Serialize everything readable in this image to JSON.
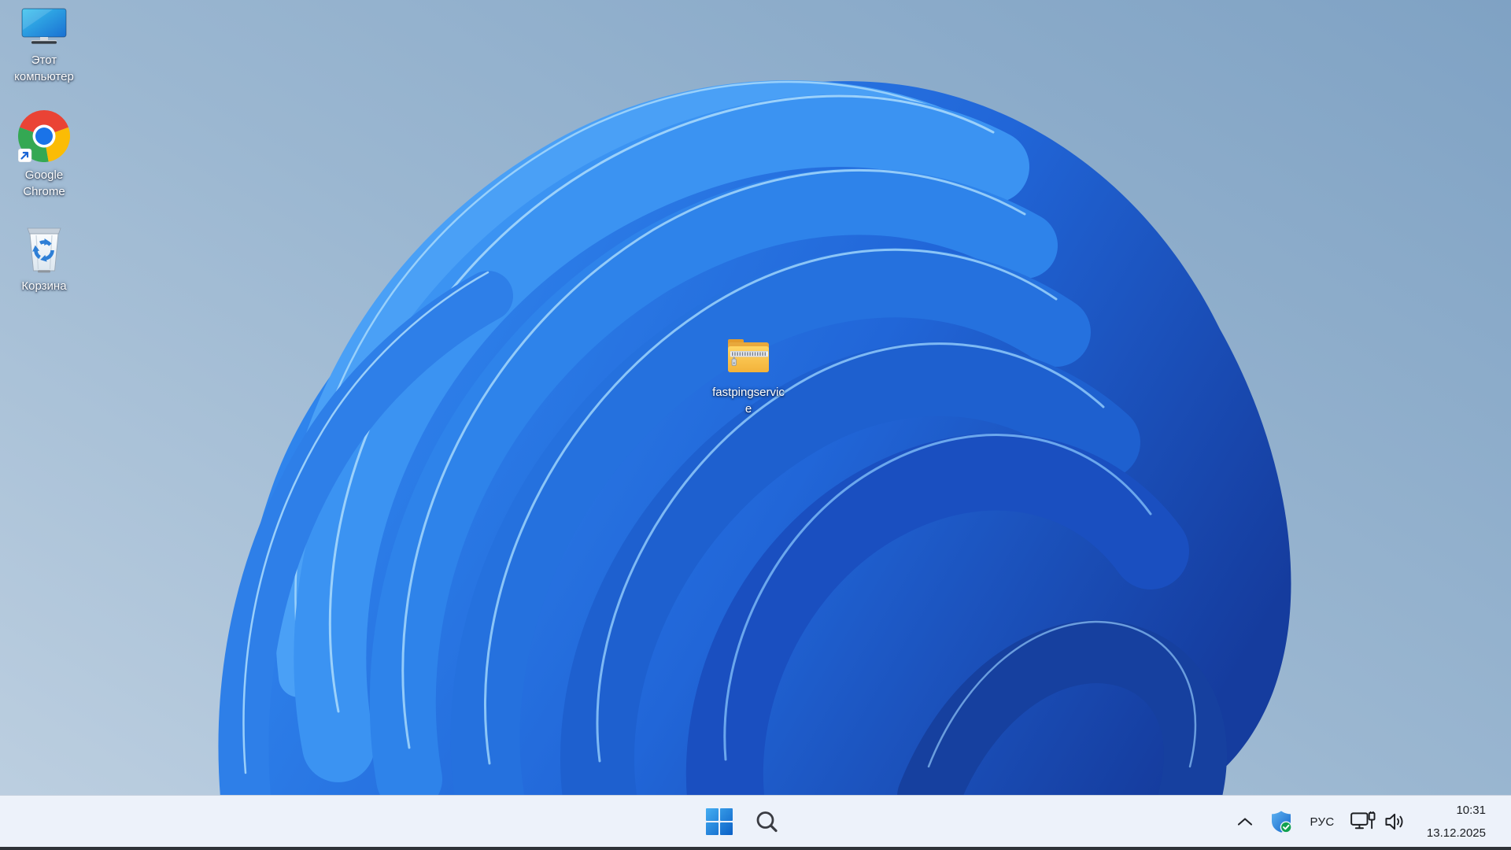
{
  "wallpaper": {
    "name": "windows-11-bloom",
    "background_top_right": "#7fa2c4",
    "background_bottom_left": "#bed0e1",
    "bloom_blues": [
      "#4aa0f6",
      "#3b93f2",
      "#2e83ea",
      "#2571de",
      "#1e60cf",
      "#1a4fc0",
      "#16409f"
    ],
    "edge_highlight": "#9ed3fb"
  },
  "desktop": {
    "icons": [
      {
        "name": "this-pc",
        "icon": "monitor-icon",
        "label": "Этот компьютер",
        "lines": [
          "Этот",
          "компьютер"
        ]
      },
      {
        "name": "google-chrome",
        "icon": "chrome-icon",
        "label": "Google Chrome",
        "lines": [
          "Google",
          "Chrome"
        ]
      },
      {
        "name": "recycle-bin",
        "icon": "recycle-bin-icon",
        "label": "Корзина",
        "lines": [
          "Корзина"
        ]
      }
    ],
    "files": [
      {
        "name": "fastpingservice",
        "icon": "zip-folder-icon",
        "label": "fastpingservice",
        "lines": [
          "fastpingservic",
          "e"
        ]
      }
    ]
  },
  "taskbar": {
    "colors": {
      "background": "#edf2fa",
      "text": "#1a1d21"
    },
    "start": {
      "icon": "windows-logo-icon"
    },
    "search": {
      "icon": "search-icon"
    },
    "tray": {
      "chevron_icon": "chevron-up-icon",
      "security_icon": "windows-security-shield-icon",
      "language": "РУС",
      "network_icon": "ethernet-monitor-icon",
      "volume_icon": "speaker-volume-icon"
    },
    "clock": {
      "time": "10:31",
      "date": "13.12.2025"
    }
  }
}
